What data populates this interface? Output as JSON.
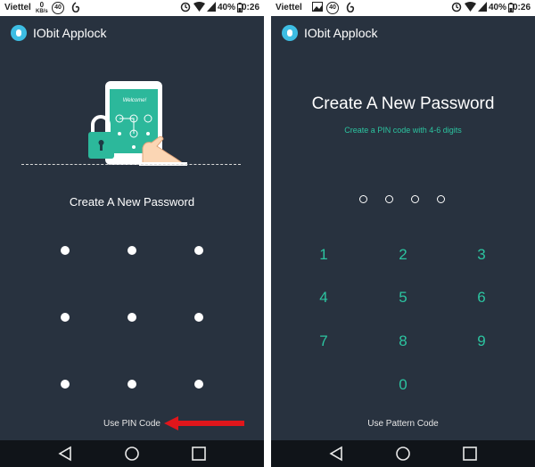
{
  "status_bar": {
    "carrier": "Viettel",
    "speed_value": "0",
    "speed_unit": "KB/s",
    "badge": "40",
    "battery": "40%",
    "time": "0:26"
  },
  "app": {
    "title": "IObit Applock"
  },
  "left_screen": {
    "illustration_text": "Welcome!",
    "title": "Create A New Password",
    "link": "Use PIN Code"
  },
  "right_screen": {
    "title": "Create A New Password",
    "subtitle": "Create a PIN code with 4-6 digits",
    "keys": [
      "1",
      "2",
      "3",
      "4",
      "5",
      "6",
      "7",
      "8",
      "9",
      "0"
    ],
    "link": "Use Pattern Code"
  },
  "colors": {
    "background": "#28323f",
    "accent": "#2cc4a0",
    "arrow": "#e0161b",
    "logo": "#3dbde3"
  }
}
